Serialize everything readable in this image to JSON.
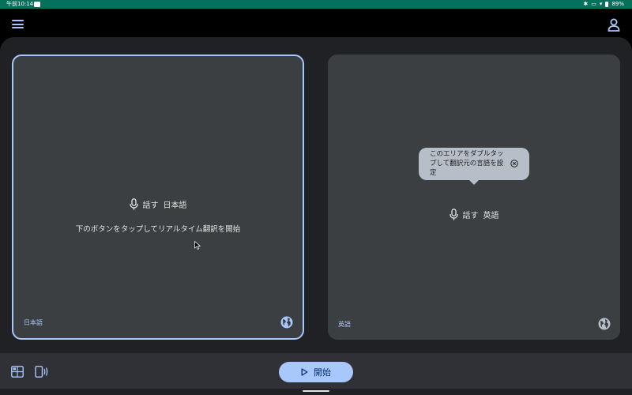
{
  "status_bar": {
    "time": "午前10:14",
    "battery": "89%",
    "indicators": [
      "bluetooth-icon",
      "sim-icon",
      "wifi-icon",
      "battery-icon"
    ]
  },
  "top_bar": {
    "icons": [
      "menu-icon",
      "account-icon"
    ]
  },
  "panels": {
    "source": {
      "speak_prefix": "話す",
      "language_name": "日本語",
      "hint": "下のボタンをタップしてリアルタイム翻訳を開始",
      "language_label": "日本語",
      "selected": true
    },
    "target": {
      "speak_prefix": "話す",
      "language_name": "英語",
      "language_label": "英語",
      "selected": false
    }
  },
  "tooltip": {
    "text": "このエリアをダブルタップして翻訳元の言語を設定"
  },
  "bottom_bar": {
    "start_label": "開始",
    "icons": [
      "layout-icon",
      "vibrate-icon",
      "play-icon"
    ]
  },
  "colors": {
    "accent": "#a8c7fa",
    "status_bar": "#05705c",
    "panel": "#3c3f41",
    "tooltip": "#b6bec7",
    "background": "#202124"
  }
}
